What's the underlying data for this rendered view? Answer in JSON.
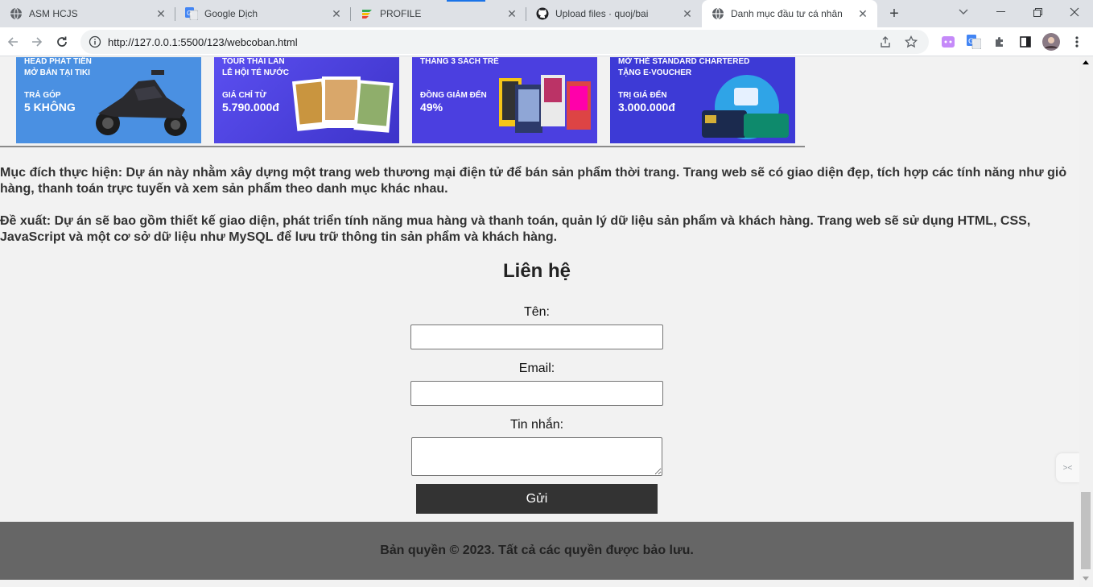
{
  "browser": {
    "tabs": [
      {
        "title": "ASM HCJS",
        "icon": "globe-icon"
      },
      {
        "title": "Google Dịch",
        "icon": "google-translate-icon"
      },
      {
        "title": "PROFILE",
        "icon": "profile-app-icon"
      },
      {
        "title": "Upload files · quoj/bai",
        "icon": "github-icon"
      },
      {
        "title": "Danh mục đầu tư cá nhân",
        "icon": "globe-icon",
        "active": true
      }
    ],
    "new_tab_glyph": "+",
    "url": "http://127.0.0.1:5500/123/webcoban.html"
  },
  "banners": [
    {
      "line1": "HEAD PHÁT TIẾN",
      "line2": "MỞ BÁN TẠI TIKI",
      "line3": "TRẢ GÓP",
      "line4": "5 KHÔNG",
      "color": "#4a90e2"
    },
    {
      "line1": "TOUR THÁI LAN",
      "line2": "LỄ HỘI TÉ NƯỚC",
      "line3": "GIÁ CHỈ TỪ",
      "line4": "5.790.000đ",
      "color": "#4b3fe0"
    },
    {
      "line1": "THÁNG 3 SÁCH TRẺ",
      "line2": "",
      "line3": "ĐỒNG GIẢM ĐẾN",
      "line4": "49%",
      "color": "#4b3fe0"
    },
    {
      "line1": "MỞ THẺ STANDARD CHARTERED",
      "line2": "TẶNG E-VOUCHER",
      "line3": "TRỊ GIÁ ĐẾN",
      "line4": "3.000.000đ",
      "color": "#3d3ad6"
    }
  ],
  "content": {
    "purpose": "Mục đích thực hiện: Dự án này nhằm xây dựng một trang web thương mại điện tử để bán sản phẩm thời trang. Trang web sẽ có giao diện đẹp, tích hợp các tính năng như giỏ hàng, thanh toán trực tuyến và xem sản phẩm theo danh mục khác nhau.",
    "proposal": "Đề xuất: Dự án sẽ bao gồm thiết kế giao diện, phát triển tính năng mua hàng và thanh toán, quản lý dữ liệu sản phẩm và khách hàng. Trang web sẽ sử dụng HTML, CSS, JavaScript và một cơ sở dữ liệu như MySQL để lưu trữ thông tin sản phẩm và khách hàng."
  },
  "contact": {
    "title": "Liên hệ",
    "name_label": "Tên:",
    "name_value": "",
    "email_label": "Email:",
    "email_value": "",
    "message_label": "Tin nhắn:",
    "message_value": "",
    "submit_label": "Gửi"
  },
  "footer": {
    "text": "Bản quyền © 2023. Tất cả các quyền được bảo lưu."
  }
}
